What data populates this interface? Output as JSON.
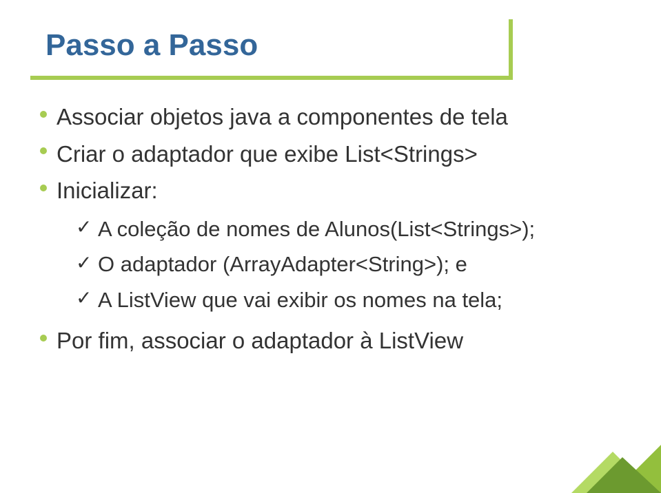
{
  "title": "Passo a Passo",
  "bullets": [
    {
      "text": "Associar objetos java a componentes de tela"
    },
    {
      "text": "Criar o adaptador que exibe List<Strings>"
    },
    {
      "text": "Inicializar:",
      "sub": [
        {
          "text": "A coleção de nomes de Alunos(List<Strings>);"
        },
        {
          "text": "O adaptador (ArrayAdapter<String>); e"
        },
        {
          "text": "A ListView que vai exibir os nomes na tela;"
        }
      ]
    },
    {
      "text": "Por fim, associar o adaptador à ListView"
    }
  ],
  "check_glyph": "✓"
}
